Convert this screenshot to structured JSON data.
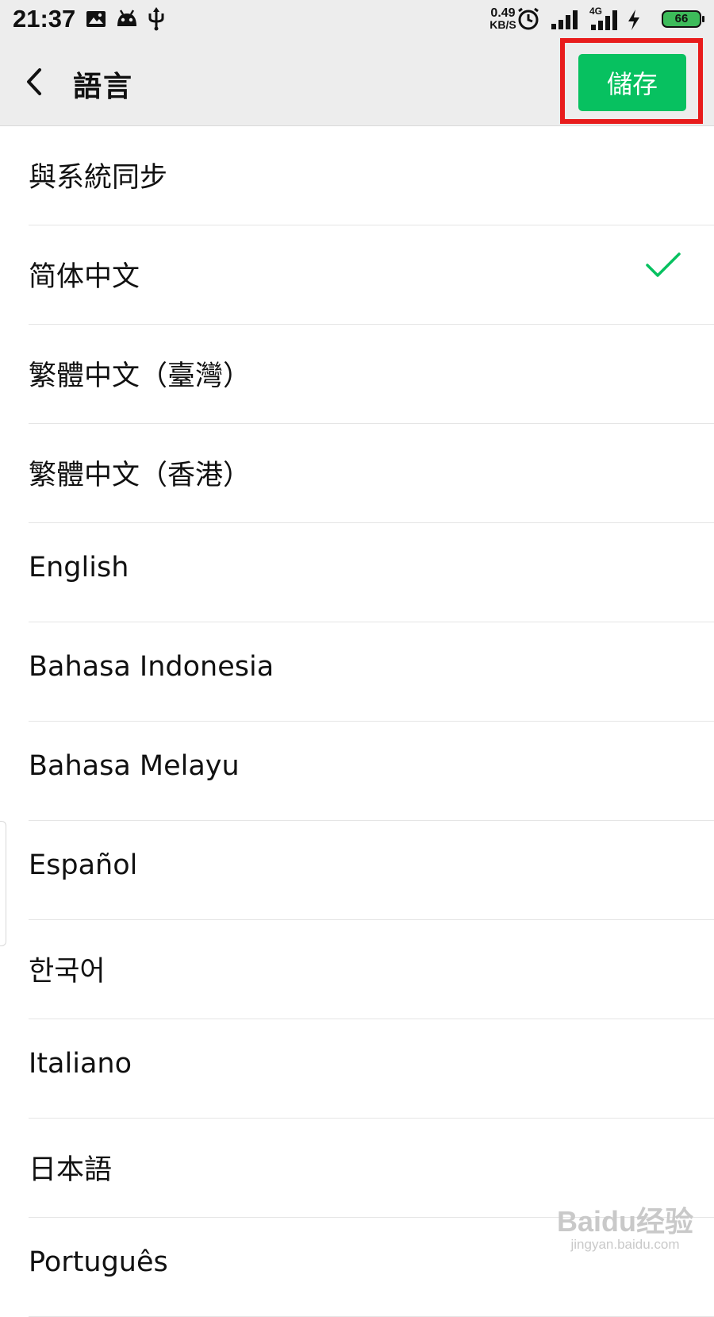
{
  "status_bar": {
    "time": "21:37",
    "net_speed_value": "0.49",
    "net_speed_unit": "KB/S",
    "network_type": "4G",
    "battery_level": "66",
    "icons": [
      "image-notification-icon",
      "android-icon",
      "usb-icon",
      "alarm-icon",
      "signal-icon",
      "signal-4g-icon",
      "charging-icon",
      "battery-icon"
    ]
  },
  "header": {
    "title": "語言",
    "save_label": "儲存"
  },
  "languages": [
    {
      "label": "與系統同步",
      "selected": false
    },
    {
      "label": "简体中文",
      "selected": true
    },
    {
      "label": "繁體中文（臺灣）",
      "selected": false
    },
    {
      "label": "繁體中文（香港）",
      "selected": false
    },
    {
      "label": "English",
      "selected": false
    },
    {
      "label": "Bahasa Indonesia",
      "selected": false
    },
    {
      "label": "Bahasa Melayu",
      "selected": false
    },
    {
      "label": "Español",
      "selected": false
    },
    {
      "label": "한국어",
      "selected": false
    },
    {
      "label": "Italiano",
      "selected": false
    },
    {
      "label": "日本語",
      "selected": false
    },
    {
      "label": "Português",
      "selected": false
    }
  ],
  "watermark": {
    "logo": "Baidu经验",
    "url": "jingyan.baidu.com"
  },
  "colors": {
    "accent": "#07c160",
    "highlight": "#e81c1c",
    "header_bg": "#ededed"
  }
}
